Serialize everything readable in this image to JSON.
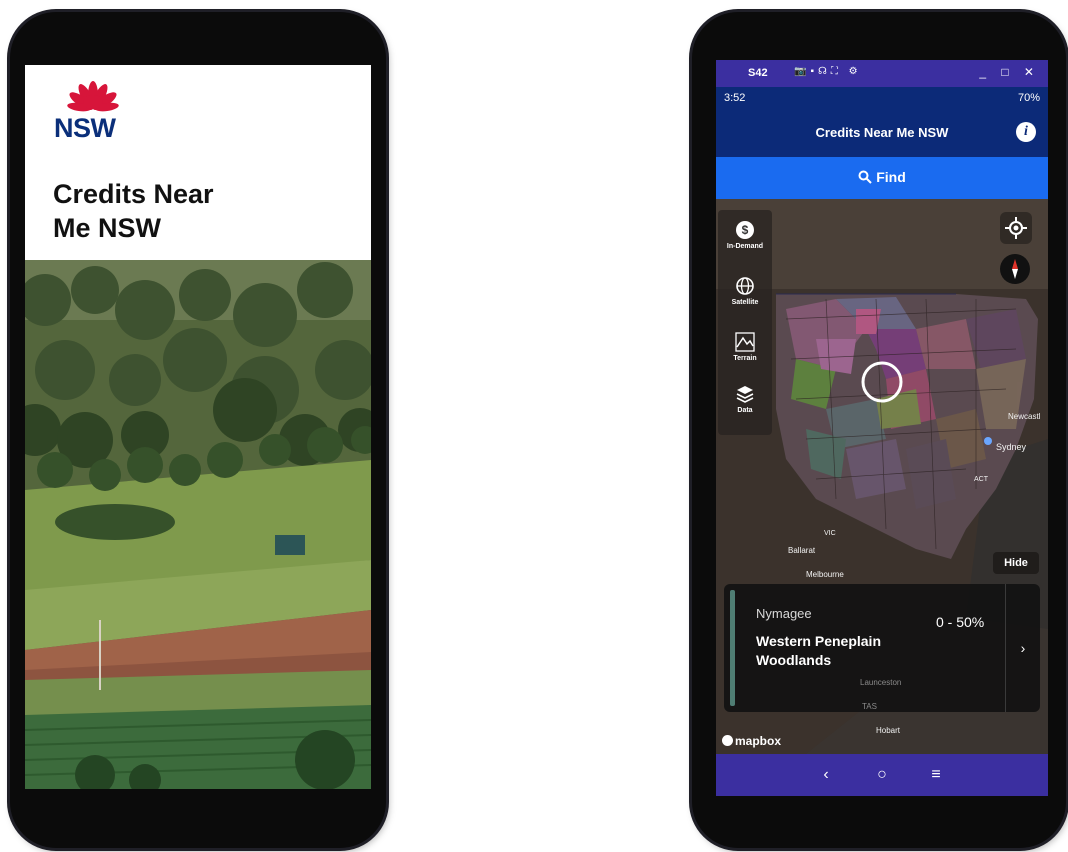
{
  "splash": {
    "logo_text": "NSW",
    "title_line1": "Credits Near",
    "title_line2": "Me NSW"
  },
  "window": {
    "title": "S42",
    "controls_label": "_ □ ✕"
  },
  "status_bar": {
    "time": "3:52",
    "battery": "70%"
  },
  "app": {
    "title": "Credits Near Me NSW",
    "info_label": "i",
    "find_label": "Find"
  },
  "map_tools": [
    {
      "label": "In-Demand",
      "icon": "dollar-icon"
    },
    {
      "label": "Satellite",
      "icon": "globe-icon"
    },
    {
      "label": "Terrain",
      "icon": "terrain-icon"
    },
    {
      "label": "Data",
      "icon": "layers-icon"
    }
  ],
  "map_labels": {
    "newcastle": "Newcastl",
    "sydney": "Sydney",
    "act": "ACT",
    "ballarat": "Ballarat",
    "vic": "VIC",
    "melbourne": "Melbourne",
    "launceston": "Launceston",
    "tas": "TAS",
    "hobart": "Hobart"
  },
  "hide_label": "Hide",
  "result_card": {
    "region": "Nymagee",
    "range": "0 - 50%",
    "name": "Western Peneplain Woodlands"
  },
  "attribution": "mapbox",
  "nav": {
    "back": "‹",
    "home": "○",
    "menu": "≡"
  },
  "colors": {
    "nsw_red": "#d7153a",
    "nsw_navy": "#0b2f7a",
    "header_navy": "#0c2a78",
    "find_blue": "#1a6bf0",
    "system_purple": "#3b2fa0"
  }
}
